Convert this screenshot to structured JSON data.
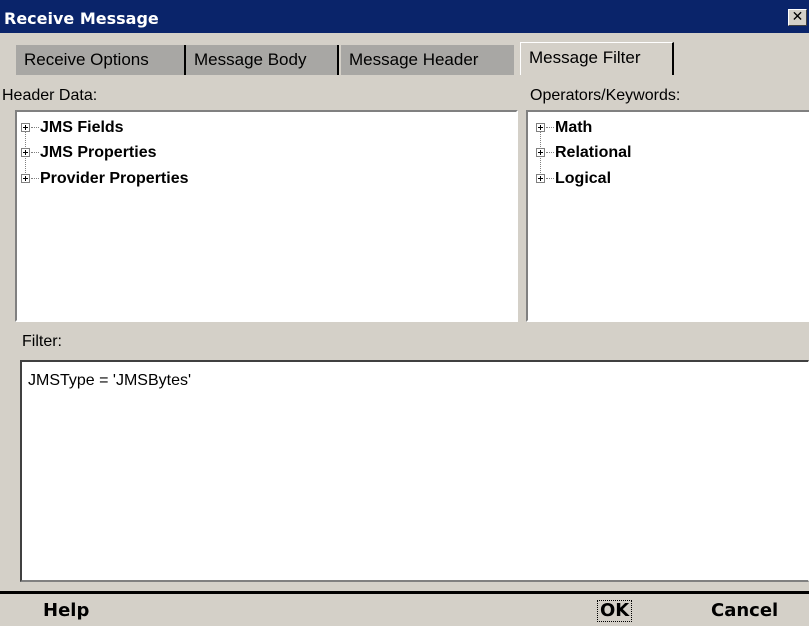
{
  "window": {
    "title": "Receive Message",
    "close_glyph": "✕"
  },
  "tabs": [
    {
      "label": "Receive Options",
      "active": false
    },
    {
      "label": "Message Body",
      "active": false
    },
    {
      "label": "Message Header",
      "active": false
    },
    {
      "label": "Message Filter",
      "active": true
    }
  ],
  "header_panel": {
    "label": "Header Data:",
    "items": [
      "JMS Fields",
      "JMS Properties",
      "Provider Properties"
    ]
  },
  "operators_panel": {
    "label": "Operators/Keywords:",
    "items": [
      "Math",
      "Relational",
      "Logical"
    ]
  },
  "filter": {
    "label": "Filter:",
    "value": "JMSType = 'JMSBytes'"
  },
  "buttons": {
    "help": "Help",
    "ok": "OK",
    "cancel": "Cancel"
  }
}
